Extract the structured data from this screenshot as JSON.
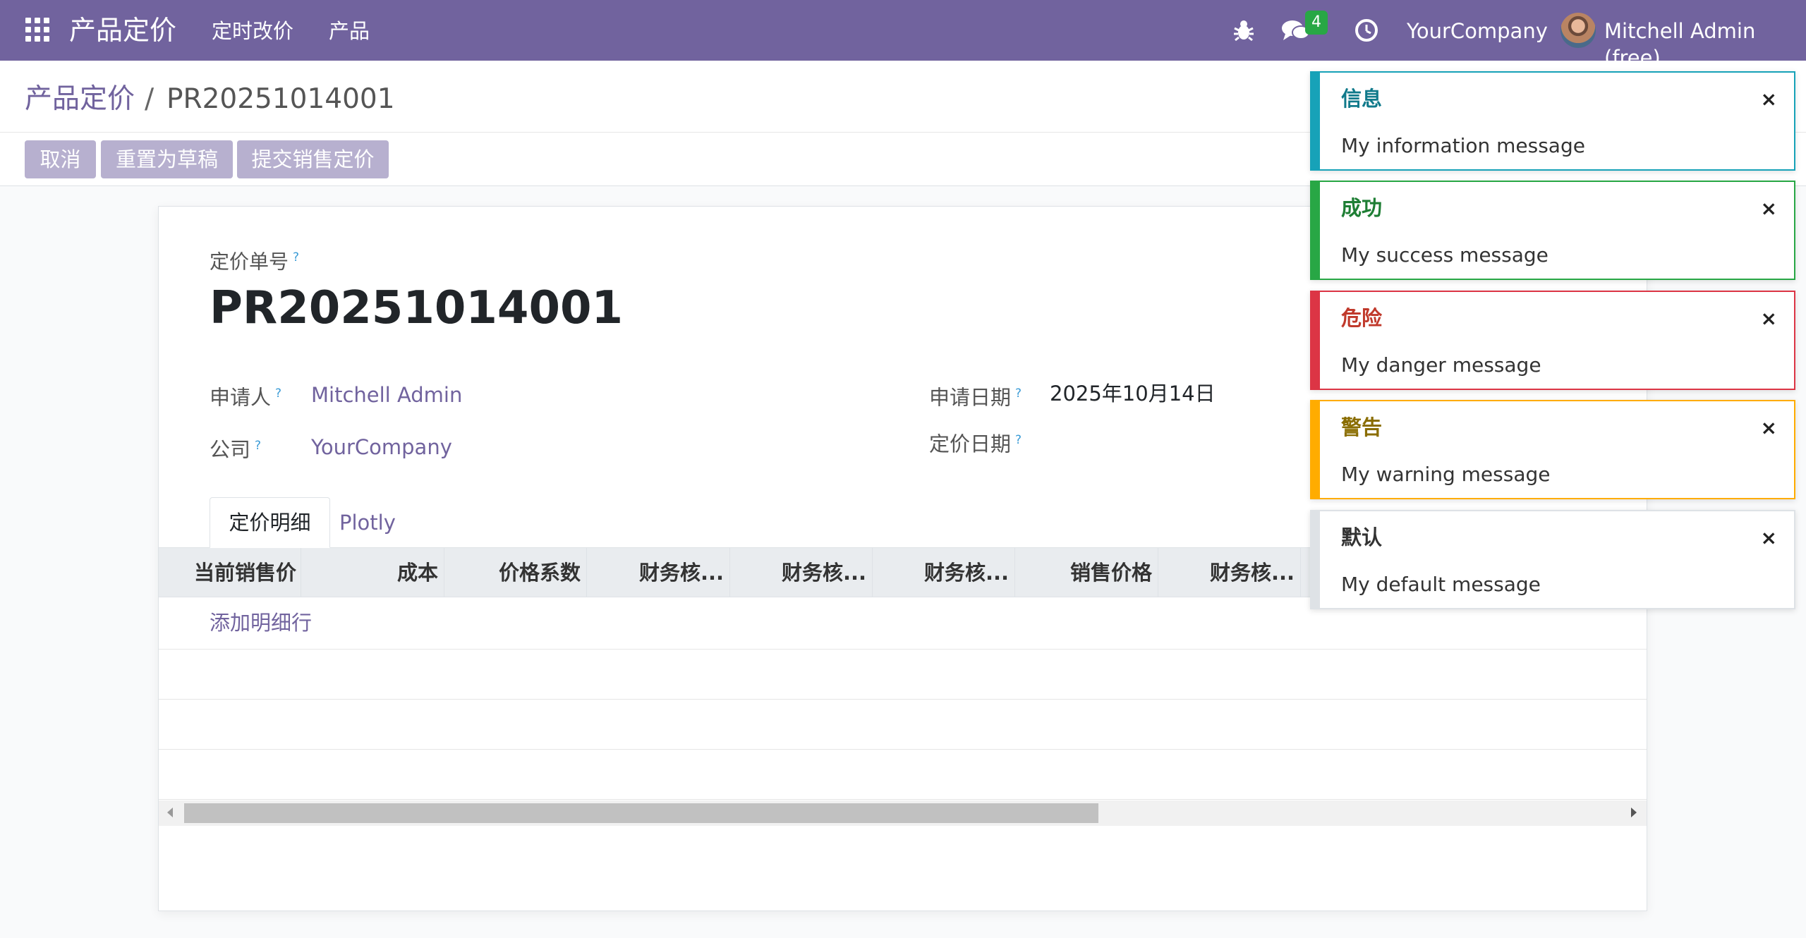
{
  "navbar": {
    "brand": "产品定价",
    "menus": [
      "定时改价",
      "产品"
    ],
    "message_count": "4",
    "company": "YourCompany",
    "user": "Mitchell Admin (free)"
  },
  "breadcrumb": {
    "parent": "产品定价",
    "separator": "/",
    "current": "PR20251014001"
  },
  "actions": {
    "cancel": "取消",
    "reset_draft": "重置为草稿",
    "submit_pricing": "提交销售定价"
  },
  "form": {
    "number_label": "定价单号",
    "number_value": "PR20251014001",
    "applicant_label": "申请人",
    "applicant_value": "Mitchell Admin",
    "company_label": "公司",
    "company_value": "YourCompany",
    "apply_date_label": "申请日期",
    "apply_date_value": "2025年10月14日",
    "pricing_date_label": "定价日期",
    "pricing_date_value": "",
    "help_mark": "?"
  },
  "tabs": [
    "定价明细",
    "Plotly"
  ],
  "table": {
    "columns": [
      "当前销售价",
      "成本",
      "价格系数",
      "财务核...",
      "财务核...",
      "财务核...",
      "销售价格",
      "财务核..."
    ],
    "add_line": "添加明细行"
  },
  "notifications": [
    {
      "title": "信息",
      "message": "My information message",
      "color": "#17a2b8",
      "title_color": "#117a8b"
    },
    {
      "title": "成功",
      "message": "My success message",
      "color": "#28a745",
      "title_color": "#1e7e34"
    },
    {
      "title": "危险",
      "message": "My danger message",
      "color": "#dc3545",
      "title_color": "#c0392b"
    },
    {
      "title": "警告",
      "message": "My warning message",
      "color": "#ffac00",
      "title_color": "#8a6d00"
    },
    {
      "title": "默认",
      "message": "My default message",
      "color": "#dee2e6",
      "title_color": "#333333"
    }
  ],
  "notification_close": "×",
  "colors": {
    "brand": "#71639e",
    "badge": "#28a745"
  }
}
